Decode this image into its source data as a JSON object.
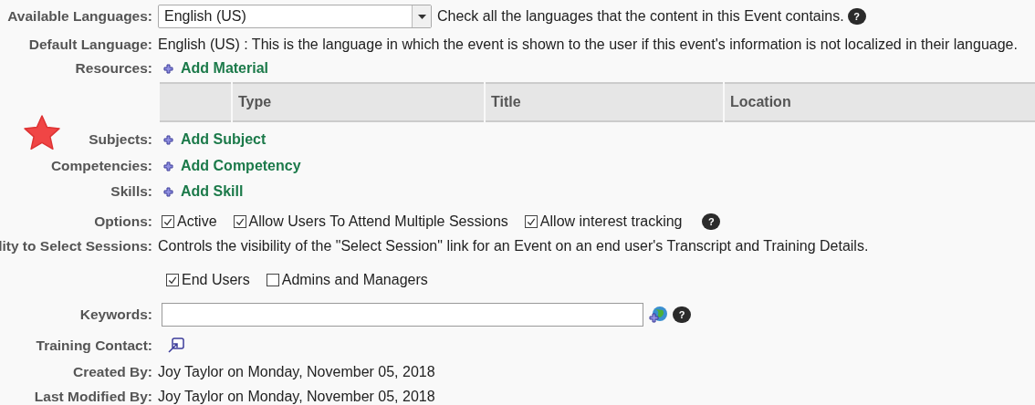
{
  "rows": [
    {
      "kind": "select",
      "label": "Available Languages:",
      "value": "English (US)",
      "hint": "Check all the languages that the content in this Event contains.",
      "help": "?"
    },
    {
      "kind": "text",
      "label": "Default Language:",
      "text": "English (US) : This is the language in which the event is shown to the user if this event's information is not localized in their language."
    },
    {
      "kind": "add",
      "label": "Resources:",
      "link": "Add Material"
    },
    {
      "kind": "table",
      "columns": [
        "",
        "Type",
        "Title",
        "Location"
      ]
    },
    {
      "kind": "add",
      "label": "Subjects:",
      "link": "Add Subject",
      "starred": true
    },
    {
      "kind": "add",
      "label": "Competencies:",
      "link": "Add Competency"
    },
    {
      "kind": "add",
      "label": "Skills:",
      "link": "Add Skill"
    },
    {
      "kind": "checks",
      "label": "Options:",
      "options": [
        {
          "label": "Active",
          "checked": true
        },
        {
          "label": "Allow Users To Attend Multiple Sessions",
          "checked": true
        },
        {
          "label": "Allow interest tracking",
          "checked": true
        }
      ],
      "help": "?"
    },
    {
      "kind": "text",
      "label": "lity to Select Sessions:",
      "text": "Controls the visibility of the \"Select Session\" link for an Event on an end user's Transcript and Training Details."
    },
    {
      "kind": "checks",
      "label": "",
      "options": [
        {
          "label": "End Users",
          "checked": true
        },
        {
          "label": "Admins and Managers",
          "checked": false
        }
      ]
    },
    {
      "kind": "input",
      "label": "Keywords:",
      "help": "?"
    },
    {
      "kind": "contact",
      "label": "Training Contact:"
    },
    {
      "kind": "text",
      "label": "Created By:",
      "text": "Joy Taylor on Monday, November 05, 2018"
    },
    {
      "kind": "text",
      "label": "Last Modified By:",
      "text": "Joy Taylor on Monday, November 05, 2018"
    }
  ]
}
